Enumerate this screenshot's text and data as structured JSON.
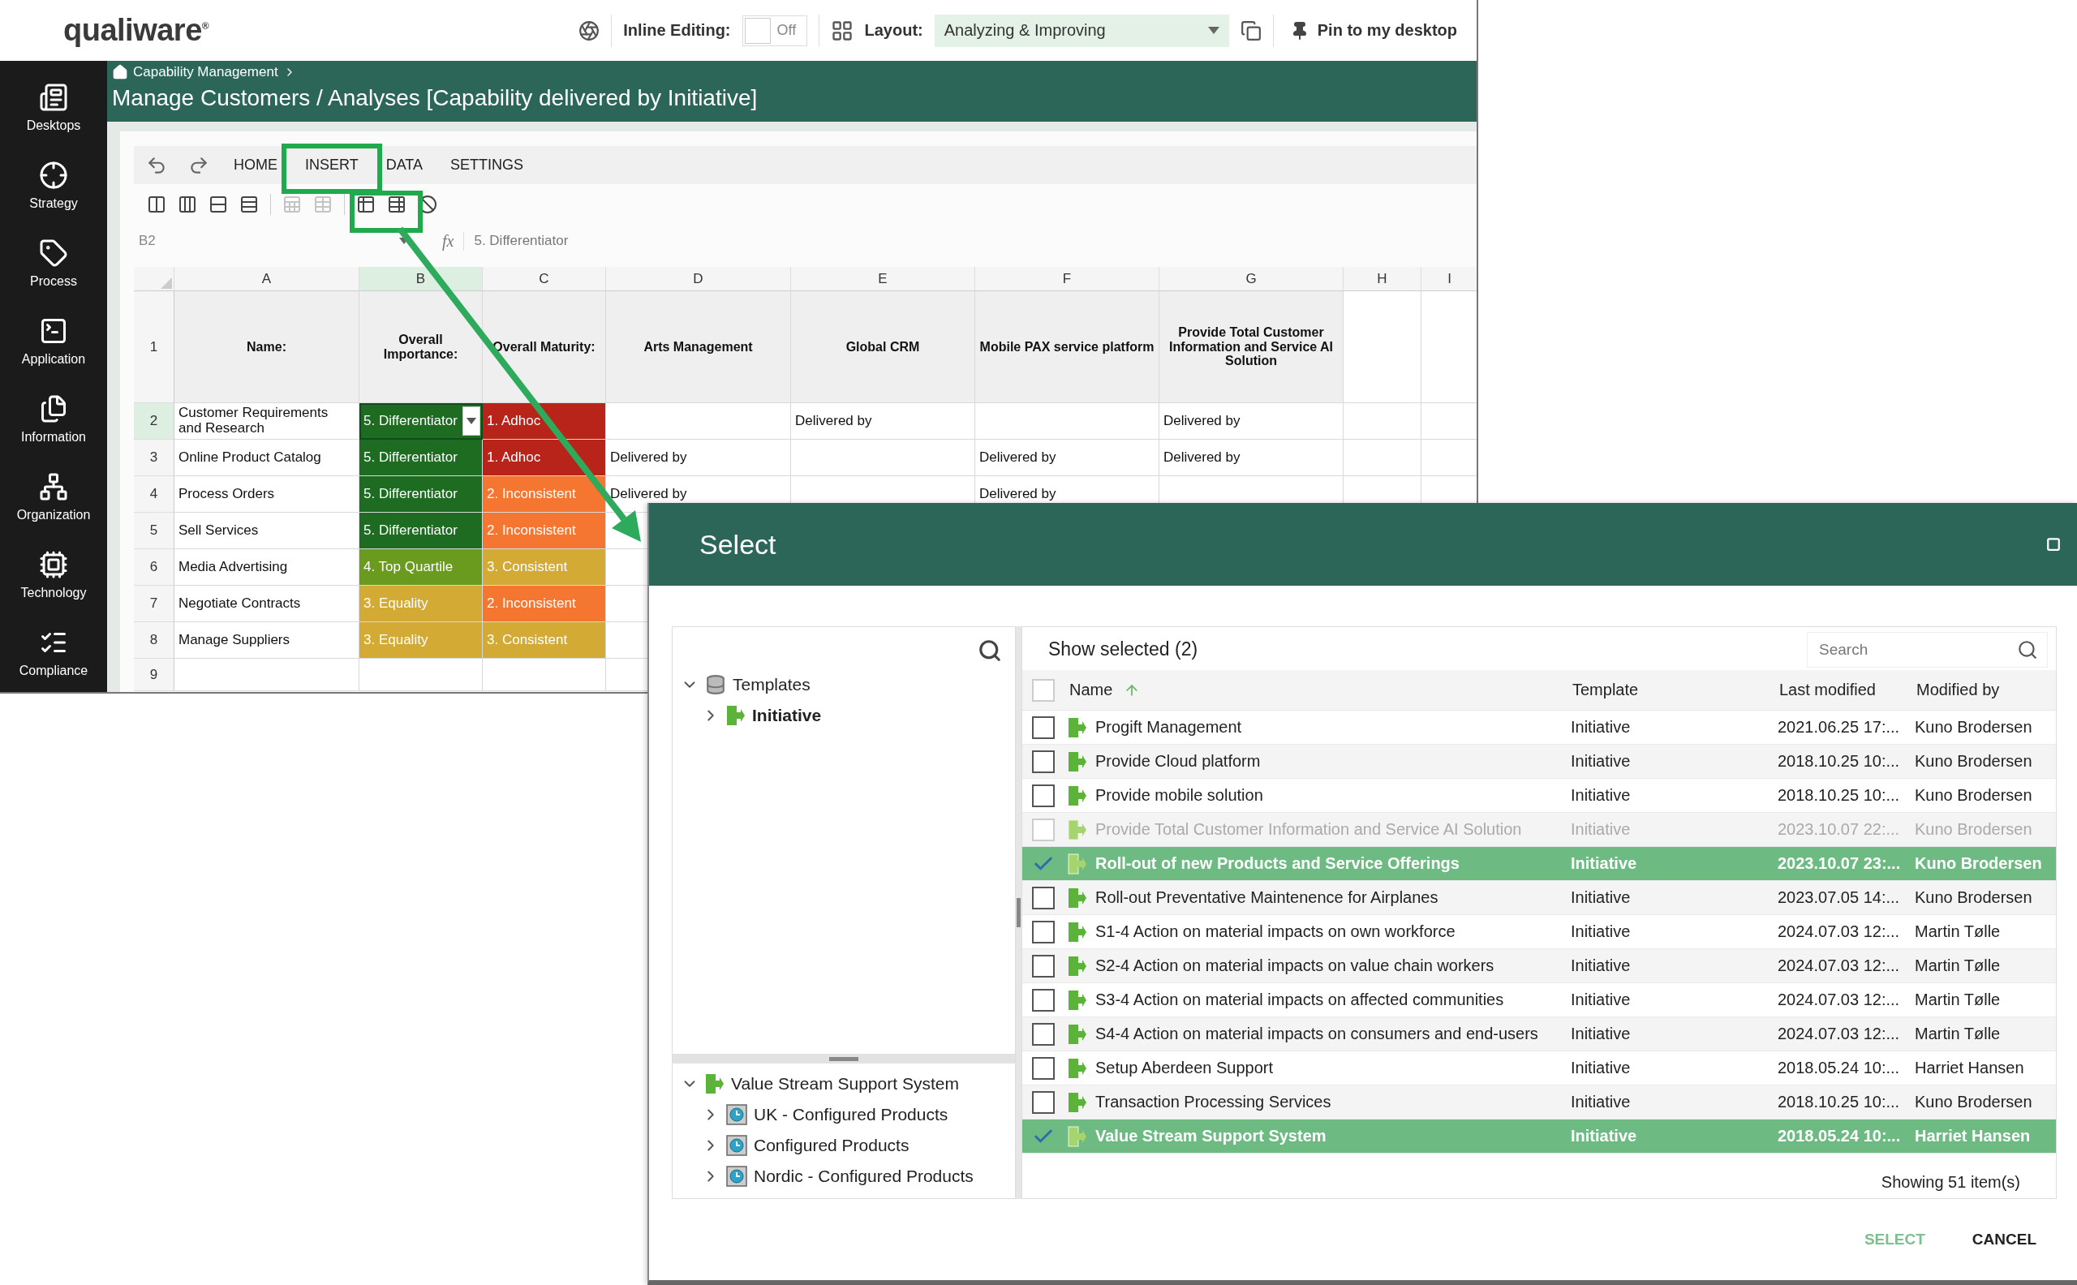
{
  "top_bar": {
    "logo": "qualiware$^{®}$",
    "inline_editing": {
      "label": "Inline Editing:",
      "on": false,
      "state_text": "Off"
    },
    "layout": {
      "label": "Layout:",
      "value": "Analyzing & Improving"
    },
    "pin_label": "Pin to my desktop"
  },
  "sidebar": {
    "items": [
      {
        "label": "Desktops"
      },
      {
        "label": "Strategy"
      },
      {
        "label": "Process"
      },
      {
        "label": "Application"
      },
      {
        "label": "Information"
      },
      {
        "label": "Organization"
      },
      {
        "label": "Technology"
      },
      {
        "label": "Compliance"
      }
    ]
  },
  "header": {
    "breadcrumb": "Capability Management",
    "title": "Manage Customers / Analyses [Capability delivered by Initiative]"
  },
  "spreadsheet": {
    "tabs": [
      {
        "label": "HOME"
      },
      {
        "label": "INSERT"
      },
      {
        "label": "DATA"
      },
      {
        "label": "SETTINGS"
      }
    ],
    "toolbar_buttons": [
      {
        "disabled": false
      },
      {
        "disabled": false
      },
      {
        "disabled": false
      },
      {
        "disabled": false
      },
      {
        "disabled": true
      },
      {
        "disabled": true
      },
      {
        "disabled": false
      },
      {
        "disabled": false
      },
      {
        "disabled": false
      }
    ],
    "name_box": "B2",
    "function_label": "fx",
    "formula": "5. Differentiator",
    "columns": [
      {
        "label": "A",
        "selected": false
      },
      {
        "label": "B",
        "selected": true
      },
      {
        "label": "C",
        "selected": false
      },
      {
        "label": "D",
        "selected": false
      },
      {
        "label": "E",
        "selected": false
      },
      {
        "label": "F",
        "selected": false
      },
      {
        "label": "G",
        "selected": false
      },
      {
        "label": "H",
        "selected": false
      },
      {
        "label": "I",
        "selected": false
      }
    ],
    "rows": [
      {
        "number": "1",
        "selected": false,
        "kind": "header",
        "cells": [
          {
            "text": "Name:"
          },
          {
            "text": "Overall Importance:"
          },
          {
            "text": "Overall Maturity:"
          },
          {
            "text": "Arts Management"
          },
          {
            "text": "Global CRM"
          },
          {
            "text": "Mobile PAX service platform"
          },
          {
            "text": "Provide Total Customer Information and Service AI Solution"
          }
        ]
      },
      {
        "number": "2",
        "selected": true,
        "kind": "data",
        "cells": [
          {
            "text": "Customer Requirements and Research"
          },
          {
            "text": "5. Differentiator",
            "color": "#1e6b22"
          },
          {
            "text": "1. Adhoc",
            "color": "#b8231a"
          },
          null,
          {
            "text": "Delivered by"
          },
          null,
          {
            "text": "Delivered by"
          }
        ]
      },
      {
        "number": "3",
        "selected": false,
        "kind": "data",
        "cells": [
          {
            "text": "Online Product Catalog"
          },
          {
            "text": "5. Differentiator",
            "color": "#1e6b22"
          },
          {
            "text": "1. Adhoc",
            "color": "#b8231a"
          },
          {
            "text": "Delivered by"
          },
          null,
          {
            "text": "Delivered by"
          },
          {
            "text": "Delivered by"
          }
        ]
      },
      {
        "number": "4",
        "selected": false,
        "kind": "data",
        "cells": [
          {
            "text": "Process Orders"
          },
          {
            "text": "5. Differentiator",
            "color": "#1e6b22"
          },
          {
            "text": "2. Inconsistent",
            "color": "#f47630"
          },
          {
            "text": "Delivered by"
          },
          null,
          {
            "text": "Delivered by"
          }
        ]
      },
      {
        "number": "5",
        "selected": false,
        "kind": "data",
        "cells": [
          {
            "text": "Sell Services"
          },
          {
            "text": "5. Differentiator",
            "color": "#1e6b22"
          },
          {
            "text": "2. Inconsistent",
            "color": "#f47630"
          }
        ]
      },
      {
        "number": "6",
        "selected": false,
        "kind": "data",
        "cells": [
          {
            "text": "Media Advertising"
          },
          {
            "text": "4. Top Quartile",
            "color": "#6a9a1e"
          },
          {
            "text": "3. Consistent",
            "color": "#d2aa34"
          }
        ]
      },
      {
        "number": "7",
        "selected": false,
        "kind": "data",
        "cells": [
          {
            "text": "Negotiate Contracts"
          },
          {
            "text": "3. Equality",
            "color": "#d2aa34"
          },
          {
            "text": "2. Inconsistent",
            "color": "#f47630"
          }
        ]
      },
      {
        "number": "8",
        "selected": false,
        "kind": "data",
        "cells": [
          {
            "text": "Manage Suppliers"
          },
          {
            "text": "3. Equality",
            "color": "#d2aa34"
          },
          {
            "text": "3. Consistent",
            "color": "#d2aa34"
          }
        ]
      },
      {
        "number": "9",
        "selected": false,
        "kind": "data"
      }
    ]
  },
  "dialog": {
    "title": "Select",
    "tree_top": [
      {
        "kind": "database",
        "label": "Templates",
        "expanded": true,
        "selected": false,
        "children": [
          {
            "kind": "initiative",
            "label": "Initiative",
            "expanded": false,
            "selected": true
          }
        ]
      }
    ],
    "tree_bottom": [
      {
        "kind": "initiative",
        "label": "Value Stream Support System",
        "expanded": true,
        "selected": false,
        "children": [
          {
            "kind": "configuration",
            "label": "UK - Configured Products",
            "expanded": false,
            "selected": false
          },
          {
            "kind": "configuration",
            "label": "Configured Products",
            "expanded": false,
            "selected": false
          },
          {
            "kind": "configuration",
            "label": "Nordic - Configured Products",
            "expanded": false,
            "selected": false
          }
        ]
      }
    ],
    "list": {
      "heading": "Show selected (2)",
      "search_placeholder": "Search",
      "select_all_checked": false,
      "columns": [
        {
          "label": "Name",
          "sorted": true
        },
        {
          "label": "Template",
          "sorted": false
        },
        {
          "label": "Last modified",
          "sorted": false
        },
        {
          "label": "Modified by",
          "sorted": false
        }
      ],
      "rows": [
        {
          "name": "Progift Management",
          "template": "Initiative",
          "modified": "2021.06.25 17:...",
          "by": "Kuno Brodersen",
          "selected": false,
          "disabled": false
        },
        {
          "name": "Provide Cloud platform",
          "template": "Initiative",
          "modified": "2018.10.25 10:...",
          "by": "Kuno Brodersen",
          "selected": false,
          "disabled": false
        },
        {
          "name": "Provide mobile solution",
          "template": "Initiative",
          "modified": "2018.10.25 10:...",
          "by": "Kuno Brodersen",
          "selected": false,
          "disabled": false
        },
        {
          "name": "Provide Total Customer Information and Service AI Solution",
          "template": "Initiative",
          "modified": "2023.10.07 22:...",
          "by": "Kuno Brodersen",
          "selected": false,
          "disabled": true
        },
        {
          "name": "Roll-out of new Products and Service Offerings",
          "template": "Initiative",
          "modified": "2023.10.07 23:...",
          "by": "Kuno Brodersen",
          "selected": true,
          "disabled": false
        },
        {
          "name": "Roll-out Preventative Maintenence for Airplanes",
          "template": "Initiative",
          "modified": "2023.07.05 14:...",
          "by": "Kuno Brodersen",
          "selected": false,
          "disabled": false
        },
        {
          "name": "S1-4 Action on material impacts on own workforce",
          "template": "Initiative",
          "modified": "2024.07.03 12:...",
          "by": "Martin Tølle",
          "selected": false,
          "disabled": false
        },
        {
          "name": "S2-4 Action on material impacts on value chain workers",
          "template": "Initiative",
          "modified": "2024.07.03 12:...",
          "by": "Martin Tølle",
          "selected": false,
          "disabled": false
        },
        {
          "name": "S3-4 Action on material impacts on affected communities",
          "template": "Initiative",
          "modified": "2024.07.03 12:...",
          "by": "Martin Tølle",
          "selected": false,
          "disabled": false
        },
        {
          "name": "S4-4 Action on material impacts on consumers and end-users",
          "template": "Initiative",
          "modified": "2024.07.03 12:...",
          "by": "Martin Tølle",
          "selected": false,
          "disabled": false
        },
        {
          "name": "Setup Aberdeen Support",
          "template": "Initiative",
          "modified": "2018.05.24 10:...",
          "by": "Harriet Hansen",
          "selected": false,
          "disabled": false
        },
        {
          "name": "Transaction Processing Services",
          "template": "Initiative",
          "modified": "2018.10.25 10:...",
          "by": "Kuno Brodersen",
          "selected": false,
          "disabled": false
        },
        {
          "name": "Value Stream Support System",
          "template": "Initiative",
          "modified": "2018.05.24 10:...",
          "by": "Harriet Hansen",
          "selected": true,
          "disabled": false
        }
      ],
      "footer": "Showing 51 item(s)"
    },
    "buttons": [
      {
        "label": "SELECT",
        "kind": "primary"
      },
      {
        "label": "CANCEL",
        "kind": "plain"
      }
    ]
  }
}
